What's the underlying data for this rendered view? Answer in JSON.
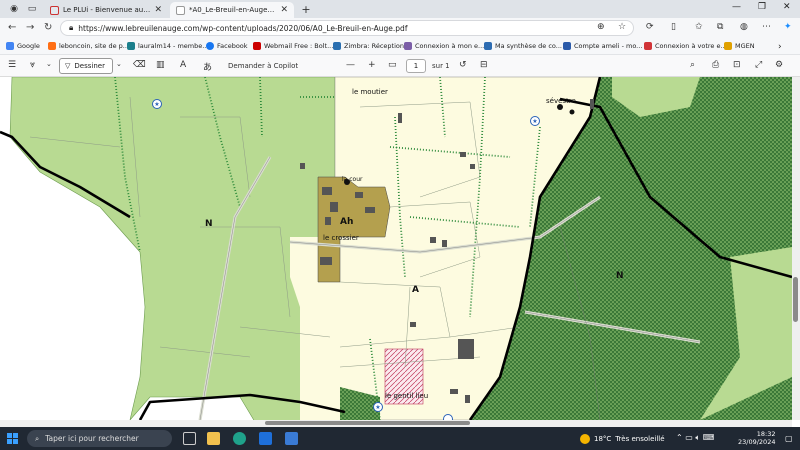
{
  "browser": {
    "tabs": [
      {
        "title": "Le PLUi - Bienvenue au Breuil en",
        "active": false
      },
      {
        "title": "*A0_Le-Breuil-en-Auge.pdf",
        "active": true
      }
    ],
    "new_tab": "+",
    "url": "https://www.lebreuilenauge.com/wp-content/uploads/2020/06/A0_Le-Breuil-en-Auge.pdf",
    "window_controls": [
      "—",
      "❐",
      "✕"
    ]
  },
  "favorites": [
    {
      "label": "Google",
      "color": "#4285f4"
    },
    {
      "label": "leboncoin, site de p...",
      "color": "#ff6e14"
    },
    {
      "label": "lauralm14 - membe...",
      "color": "#1b7f8c"
    },
    {
      "label": "Facebook",
      "color": "#1877f2"
    },
    {
      "label": "Webmail Free : Bolt...",
      "color": "#cc0000"
    },
    {
      "label": "Zimbra: Réception",
      "color": "#2a6fb0"
    },
    {
      "label": "Connexion à mon e...",
      "color": "#7b5ea7"
    },
    {
      "label": "Ma synthèse de co...",
      "color": "#2c6bb1"
    },
    {
      "label": "Compte ameli - mo...",
      "color": "#2b5aa9"
    },
    {
      "label": "Connexion à votre e...",
      "color": "#d13438"
    },
    {
      "label": "MGEN",
      "color": "#e0a100"
    }
  ],
  "pdf_toolbar": {
    "draw_label": "Dessiner",
    "copilot_label": "Demander à Copilot",
    "page_current": "1",
    "page_total": "sur 1",
    "zoom_minus": "—",
    "zoom_plus": "+"
  },
  "map": {
    "labels": [
      {
        "text": "le moutier"
      },
      {
        "text": "sévestre"
      },
      {
        "text": "le crossier"
      },
      {
        "text": "le gentil lieu"
      },
      {
        "text": "la cour"
      }
    ],
    "zones": [
      {
        "text": "N"
      },
      {
        "text": "Ah"
      },
      {
        "text": "A"
      },
      {
        "text": "N"
      }
    ],
    "colors": {
      "natural_zone": "#b5d98e",
      "agricultural_zone": "#fdfbe0",
      "hamlet_zone": "#b4a04e",
      "forest": "#3d7a3a",
      "boundary": "#000000"
    }
  },
  "taskbar": {
    "search_placeholder": "Taper ici pour rechercher",
    "weather_temp": "18°C",
    "weather_desc": "Très ensoleillé",
    "time": "18:32",
    "date": "23/09/2024"
  }
}
